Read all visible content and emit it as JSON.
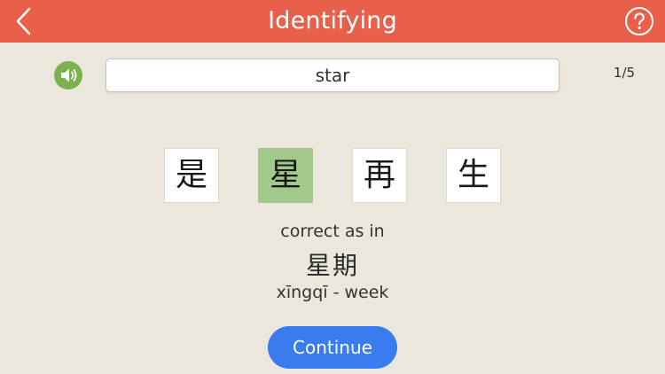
{
  "header": {
    "title": "Identifying",
    "back_icon": "chevron-left-icon",
    "help_icon": "question-circle-icon"
  },
  "prompt": {
    "speaker_icon": "speaker-icon",
    "word": "star",
    "progress": "1/5"
  },
  "choices": [
    {
      "char": "是",
      "selected": false
    },
    {
      "char": "星",
      "selected": true
    },
    {
      "char": "再",
      "selected": false
    },
    {
      "char": "生",
      "selected": false
    }
  ],
  "feedback": {
    "message": "correct as in",
    "example": "星期",
    "pinyin": "xīngqī - week"
  },
  "continue_label": "Continue",
  "colors": {
    "header": "#E8604A",
    "background": "#EBE7DC",
    "speaker": "#7DB04F",
    "selected_tile": "#A2C98A",
    "continue_button": "#3A7BEF"
  }
}
